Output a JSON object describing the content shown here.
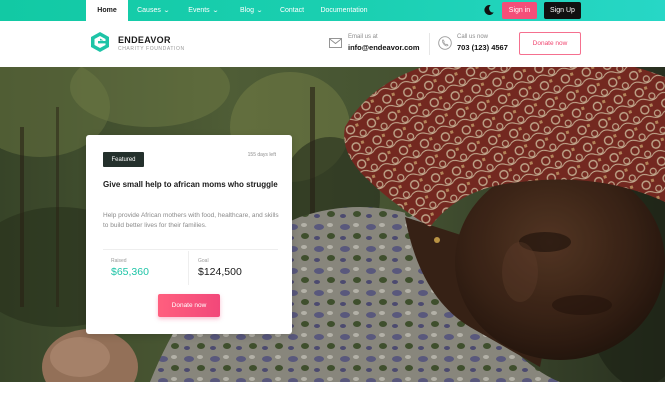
{
  "nav": {
    "items": [
      {
        "label": "Home",
        "active": true,
        "dropdown": false
      },
      {
        "label": "Causes",
        "active": false,
        "dropdown": true
      },
      {
        "label": "Events",
        "active": false,
        "dropdown": true
      },
      {
        "label": "Blog",
        "active": false,
        "dropdown": true
      },
      {
        "label": "Contact",
        "active": false,
        "dropdown": false
      },
      {
        "label": "Documentation",
        "active": false,
        "dropdown": false
      }
    ],
    "theme_icon": "moon-icon",
    "signin_label": "Sign in",
    "signup_label": "Sign Up"
  },
  "header": {
    "logo_name": "ENDEAVOR",
    "logo_sub": "CHARITY FOUNDATION",
    "email_label": "Email us at",
    "email_value": "info@endeavor.com",
    "call_label": "Call us now",
    "call_value": "703 (123) 4567",
    "donate_label": "Donate now"
  },
  "featured": {
    "badge": "Featured",
    "days_left": "155 days left",
    "title": "Give small help to african moms who struggle",
    "description": "Help provide African mothers with food, healthcare, and skills to build better lives for their families.",
    "raised_label": "Raised",
    "raised_value": "$65,360",
    "goal_label": "Goal",
    "goal_value": "$124,500",
    "donate_label": "Donate now"
  },
  "colors": {
    "brand_teal": "#1ec4a7",
    "accent_pink": "#f54e79",
    "dark": "#111111"
  }
}
